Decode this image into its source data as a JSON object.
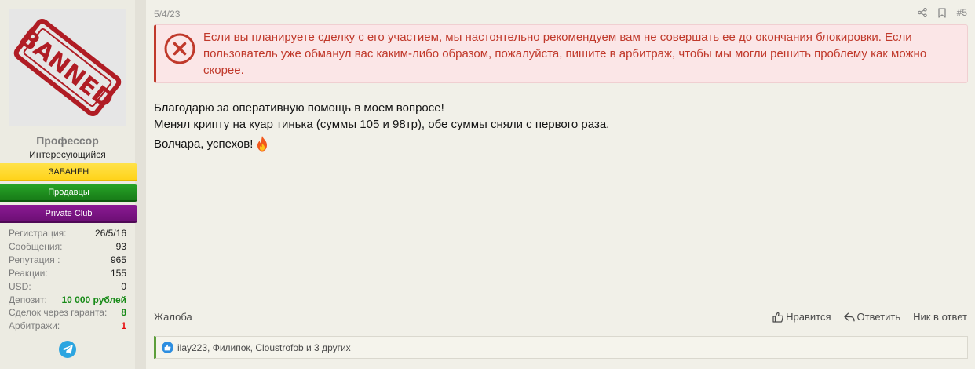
{
  "user": {
    "username": "Профессор",
    "title": "Интересующийся",
    "avatar_text": "BANNED",
    "banners": {
      "banned": "ЗАБАНЕН",
      "sellers": "Продавцы",
      "private": "Private Club"
    },
    "stats": [
      {
        "label": "Регистрация:",
        "value": "26/5/16"
      },
      {
        "label": "Сообщения:",
        "value": "93"
      },
      {
        "label": "Репутация :",
        "value": "965"
      },
      {
        "label": "Реакции:",
        "value": "155"
      },
      {
        "label": "USD:",
        "value": "0"
      },
      {
        "label": "Депозит:",
        "value": "10 000 рублей"
      },
      {
        "label": "Сделок через гаранта:",
        "value": "8"
      },
      {
        "label": "Арбитражи:",
        "value": "1"
      }
    ]
  },
  "post": {
    "date": "5/4/23",
    "number": "#5",
    "warning": "Если вы планируете сделку с его участием, мы настоятельно рекомендуем вам не совершать ее до окончания блокировки. Если пользователь уже обманул вас каким-либо образом, пожалуйста, пишите в арбитраж, чтобы мы могли решить проблему как можно скорее.",
    "message_lines": [
      "Благодарю за оперативную помощь в моем вопросе!",
      "Менял крипту на куар тинька (суммы 105 и 98тр), обе суммы сняли с первого раза.",
      "Волчара, успехов!"
    ],
    "report_label": "Жалоба",
    "like_label": "Нравится",
    "reply_label": "Ответить",
    "mention_label": "Ник в ответ",
    "reactions_text": "ilay223, Филипок, Cloustrofob и 3 других"
  },
  "colors": {
    "warning_red": "#c0392b",
    "banned_yellow": "#ffd31a",
    "sellers_green": "#187c18",
    "private_purple": "#6d0f75",
    "deposit_green": "#178a17",
    "arbitrage_red": "#e60d0d",
    "like_blue": "#2d8ee0"
  }
}
